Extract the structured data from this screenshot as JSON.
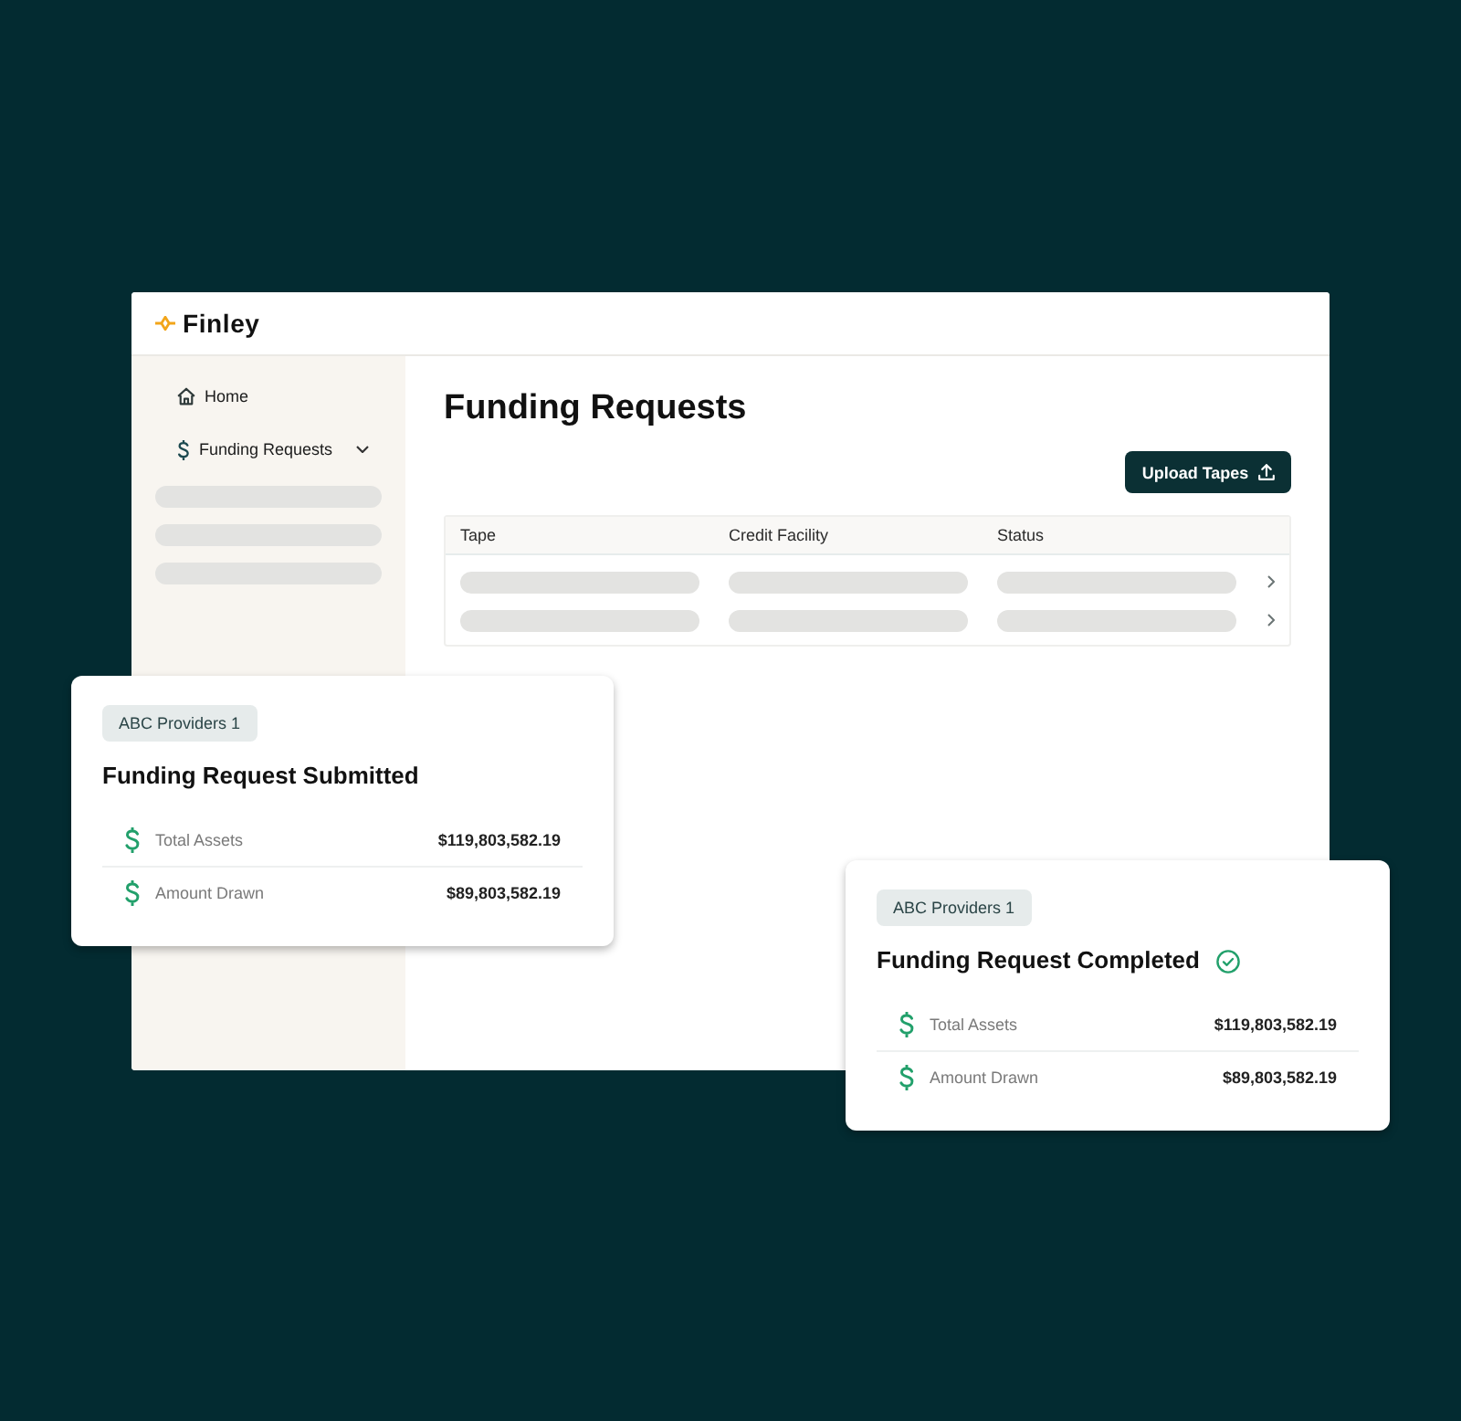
{
  "window": {
    "logo": "Finley"
  },
  "sidebar": {
    "items": [
      {
        "label": "Home",
        "kind": "home",
        "selected": false
      },
      {
        "label": "Funding Requests",
        "kind": "funds",
        "selected": false,
        "expanded": true,
        "children": [
          {
            "kind": "skeleton"
          },
          {
            "kind": "skeleton"
          },
          {
            "kind": "skeleton"
          }
        ]
      }
    ]
  },
  "page": {
    "title": "Funding Requests",
    "upload_button": "Upload Tapes"
  },
  "table": {
    "columns": [
      "Tape",
      "Credit Facility",
      "Status"
    ],
    "rows": [
      {
        "kind": "skeleton"
      },
      {
        "kind": "skeleton"
      }
    ]
  },
  "cards": [
    {
      "badge": "ABC Providers 1",
      "title": "Funding Request Submitted",
      "completed": false,
      "metrics": [
        {
          "label": "Total Assets",
          "value": "$119,803,582.19"
        },
        {
          "label": "Amount Drawn",
          "value": "$89,803,582.19"
        }
      ]
    },
    {
      "badge": "ABC Providers 1",
      "title": "Funding Request Completed",
      "completed": true,
      "metrics": [
        {
          "label": "Total Assets",
          "value": "$119,803,582.19"
        },
        {
          "label": "Amount Drawn",
          "value": "$89,803,582.19"
        }
      ]
    }
  ]
}
